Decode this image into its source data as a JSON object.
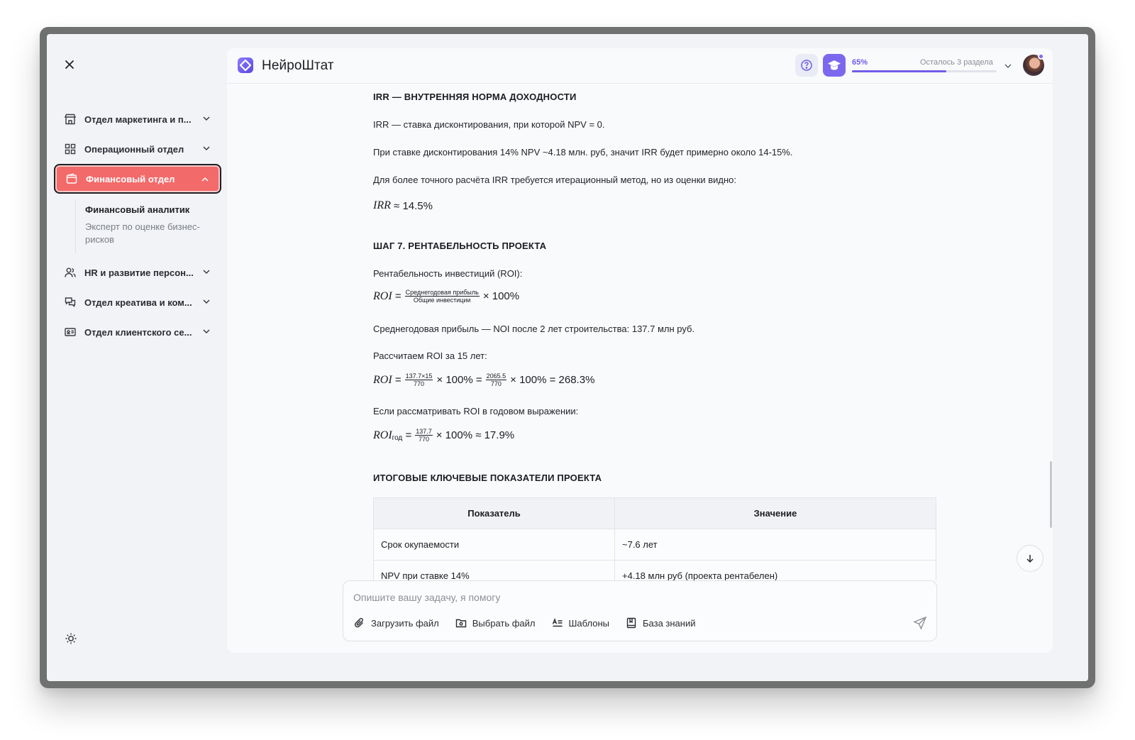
{
  "app": {
    "brand": "НейроШтат"
  },
  "sidebar": {
    "items": [
      {
        "label": "Отдел маркетинга и п..."
      },
      {
        "label": "Операционный отдел"
      },
      {
        "label": "Финансовый отдел"
      },
      {
        "label": "HR и развитие персон..."
      },
      {
        "label": "Отдел креатива и ком..."
      },
      {
        "label": "Отдел клиентского се..."
      }
    ],
    "subitems": [
      {
        "label": "Финансовый аналитик"
      },
      {
        "label": "Эксперт по оценке бизнес-рисков"
      }
    ]
  },
  "header": {
    "progress_percent": "65%",
    "progress_value": 0.65,
    "progress_remaining": "Осталось 3 раздела"
  },
  "content": {
    "irr_heading": "IRR — ВНУТРЕННЯЯ НОРМА ДОХОДНОСТИ",
    "irr_p1": "IRR — ставка дисконтирования, при которой NPV = 0.",
    "irr_p2": "При ставке дисконтирования 14% NPV ~4.18 млн. руб, значит IRR будет примерно около 14-15%.",
    "irr_p3": "Для более точного расчёта IRR требуется итерационный метод, но из оценки видно:",
    "irr_formula_var": "IRR",
    "irr_formula_rest": "≈ 14.5%",
    "step7_heading": "ШАГ 7. РЕНТАБЕЛЬНОСТЬ ПРОЕКТА",
    "roi_intro": "Рентабельность инвестиций (ROI):",
    "roi_var": "ROI",
    "eq": "=",
    "roi_num": "Среднегодовая прибыль",
    "roi_den": "Общие инвестиции",
    "roi_times": "× 100%",
    "noi_text": "Среднегодовая прибыль — NOI после 2 лет строительства: 137.7 млн руб.",
    "roi15_text": "Рассчитаем ROI за 15 лет:",
    "roi15_num1": "137.7×15",
    "roi15_den1": "770",
    "roi15_mid": "× 100% =",
    "roi15_num2": "2065.5",
    "roi15_den2": "770",
    "roi15_end": "× 100% = 268.3%",
    "roi_year_text": "Если рассматривать ROI в годовом выражении:",
    "roi_year_sub": "год",
    "roi_year_num": "137.7",
    "roi_year_den": "770",
    "roi_year_end": "× 100% ≈ 17.9%",
    "summary_heading": "ИТОГОВЫЕ КЛЮЧЕВЫЕ ПОКАЗАТЕЛИ ПРОЕКТА",
    "table": {
      "headers": [
        "Показатель",
        "Значение"
      ],
      "rows": [
        [
          "Срок окупаемости",
          "~7.6 лет"
        ],
        [
          "NPV при ставке 14%",
          "+4.18 млн руб (проекта рентабелен)"
        ]
      ]
    }
  },
  "composer": {
    "placeholder": "Опишите вашу задачу, я помогу",
    "upload": "Загрузить файл",
    "choose": "Выбрать файл",
    "templates": "Шаблоны",
    "knowledge": "База знаний"
  },
  "colors": {
    "accent": "#7b68ee",
    "active_nav": "#f36a6a"
  }
}
